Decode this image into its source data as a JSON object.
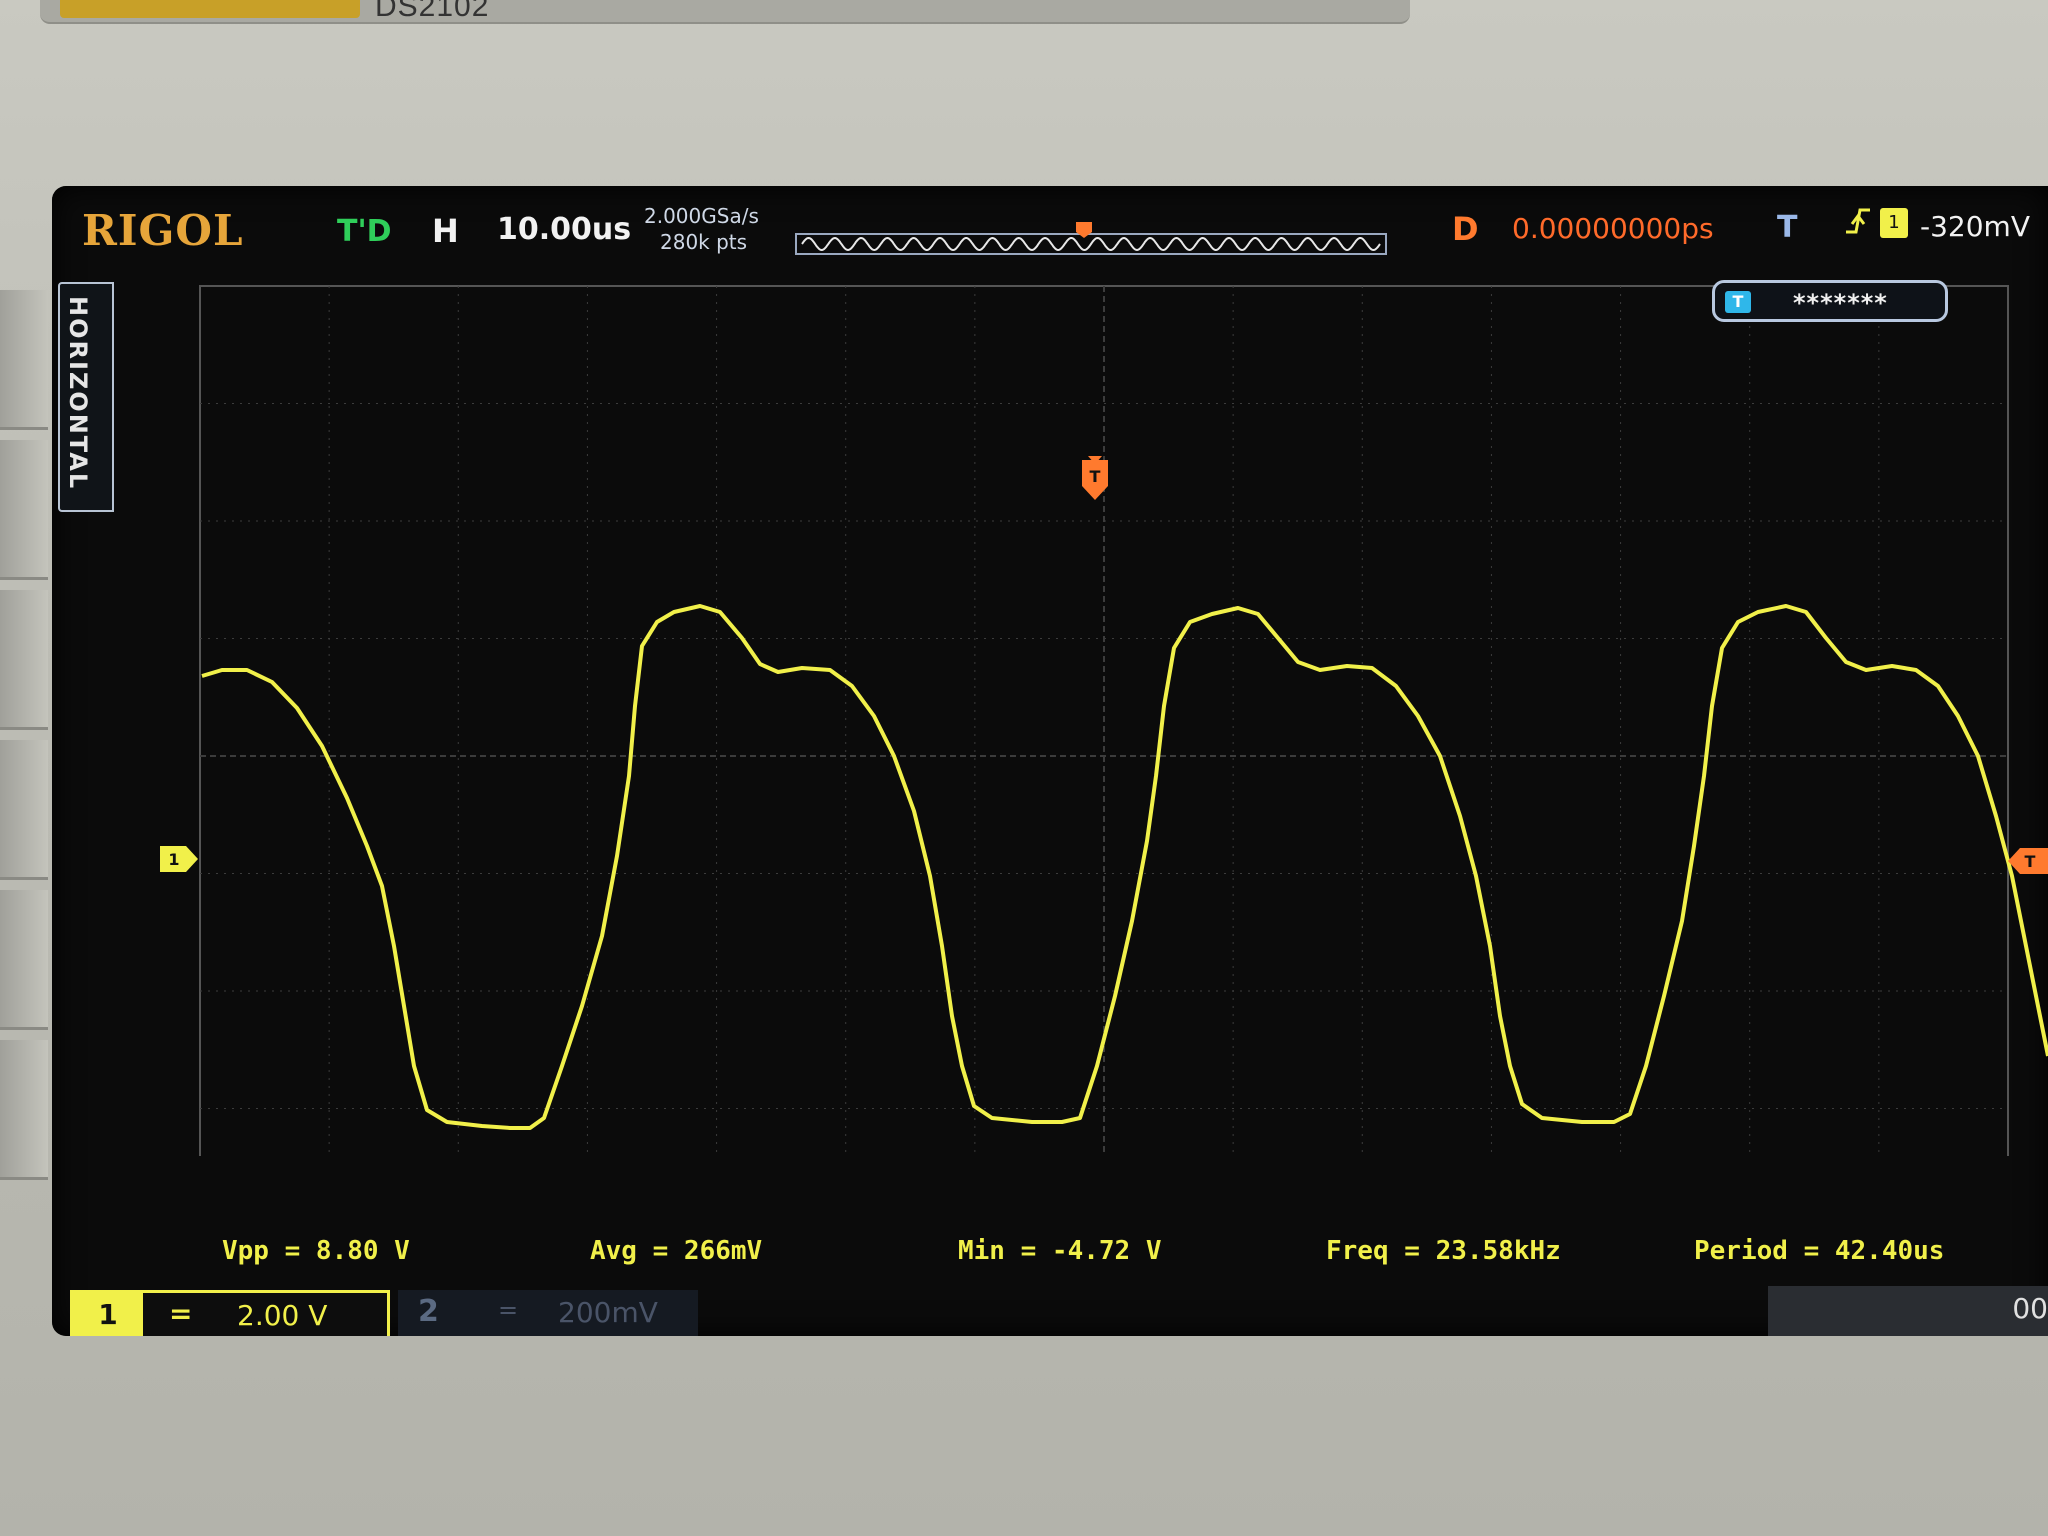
{
  "device": {
    "model_strip": "DS2102"
  },
  "status": {
    "logo": "RIGOL",
    "run_state": "T'D",
    "horizontal_label": "H",
    "horizontal_scale": "10.00us",
    "sample_rate": "2.000GSa/s",
    "memory_depth": "280k pts",
    "delay_label": "D",
    "delay_value": "0.00000000ps",
    "trigger_label": "T",
    "trigger_source": "1",
    "trigger_level": "-320mV"
  },
  "side_tab": {
    "label": "HORIZONTAL"
  },
  "label_badge": {
    "icon_text": "T",
    "text": "*******"
  },
  "markers": {
    "ch1_ground": "1",
    "trigger_pos": "T",
    "trigger_level": "T"
  },
  "measurements": {
    "vpp": "Vpp = 8.80 V",
    "avg": "Avg = 266mV",
    "min": "Min = -4.72 V",
    "freq": "Freq = 23.58kHz",
    "period": "Period = 42.40us"
  },
  "channels": {
    "ch1": {
      "number": "1",
      "coupling": "=",
      "scale": "2.00 V"
    },
    "ch2": {
      "number": "2",
      "coupling": "=",
      "scale": "200mV"
    },
    "right_text": "00"
  },
  "colors": {
    "trace": "#f1f04a",
    "grid": "#3c3c3c",
    "trigger": "#ff7a2e",
    "status_green": "#2fcf5a"
  }
}
